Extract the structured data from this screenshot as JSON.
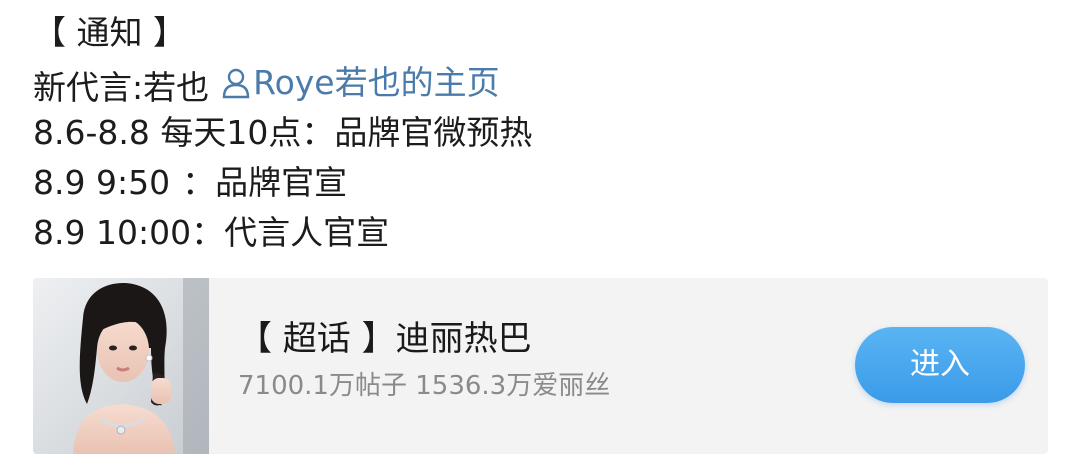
{
  "post": {
    "notice_heading": "【 通知 】",
    "spokesperson_label": "新代言:若也",
    "mention": {
      "icon": "user-outline-icon",
      "text": "Roye若也的主页"
    },
    "schedule": [
      {
        "date": "8.6-8.8 每天10点",
        "sep": "：",
        "event": "品牌官微预热"
      },
      {
        "date": "8.9 9:50",
        "sep": "：",
        "event": "品牌官宣"
      },
      {
        "date": "8.9 10:00",
        "sep": "：",
        "event": "代言人官宣"
      }
    ]
  },
  "super_topic_card": {
    "title": "【 超话 】迪丽热巴",
    "stats": "7100.1万帖子 1536.3万爱丽丝",
    "enter_label": "进入",
    "colors": {
      "button_top": "#5ab4f3",
      "button_bottom": "#3b9be9",
      "card_bg": "#f3f3f3",
      "mention_link": "#4a7bab"
    }
  }
}
